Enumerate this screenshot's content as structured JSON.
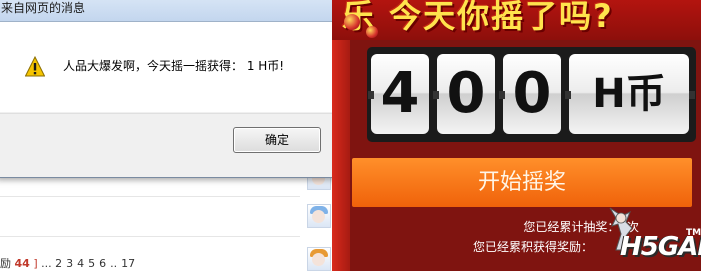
{
  "dialog": {
    "title": "来自网页的消息",
    "message": "人品大爆发啊，今天摇一摇获得： 1 H币!",
    "ok_label": "确定"
  },
  "page": {
    "pager": {
      "prefix": "励",
      "current": "44",
      "bracket_close": "]",
      "ellipsis": "...",
      "pages": [
        "2",
        "3",
        "4",
        "5",
        "6",
        "..",
        "17"
      ]
    }
  },
  "lottery": {
    "banner": "乐 今天你摇了吗?",
    "digits": [
      "4",
      "0",
      "0"
    ],
    "unit": "H币",
    "start_label": "开始摇奖",
    "draw_count_text": "您已经累计抽奖：3次",
    "reward_text": "您已经累积获得奖励：",
    "logo_text": "H5GAL",
    "logo_tm": "TM",
    "colors": {
      "panel_bg": "#7f1410",
      "start_button": "#f47a1c",
      "banner_text": "#ffe34d"
    }
  }
}
